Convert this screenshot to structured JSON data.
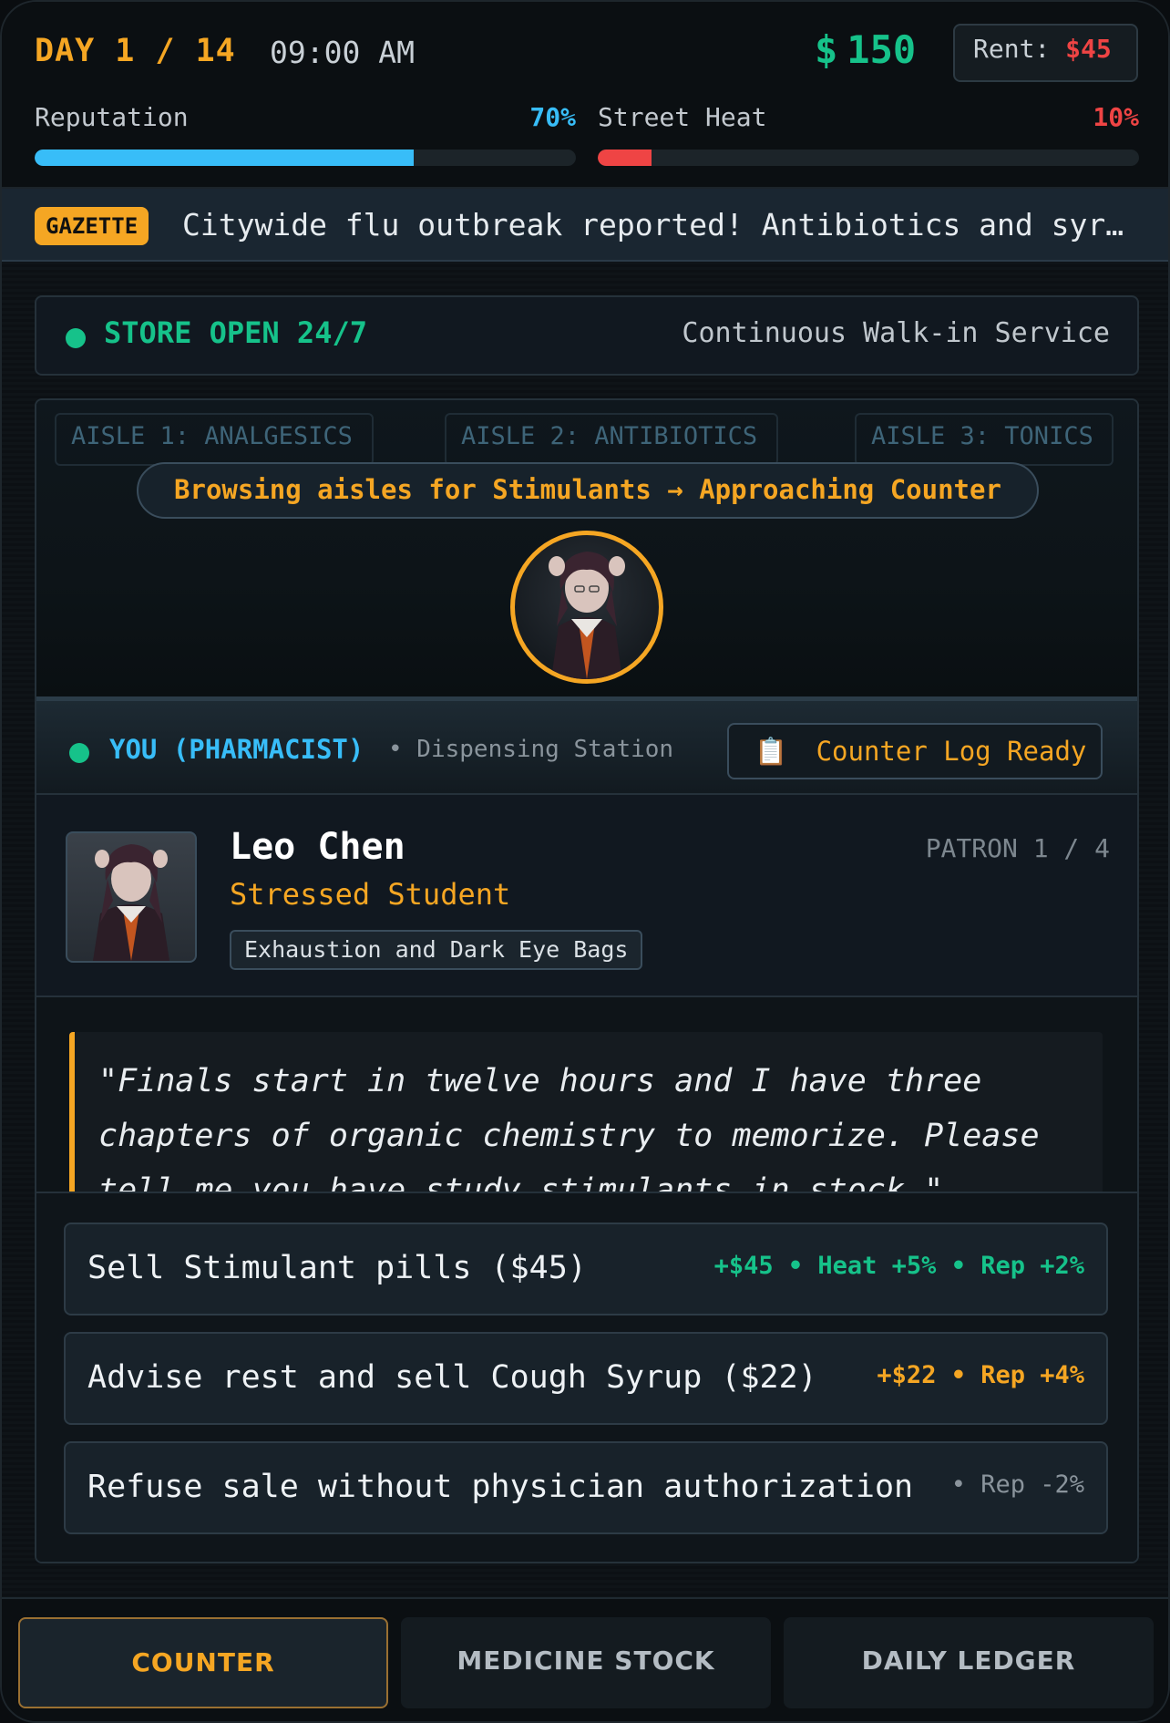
{
  "header": {
    "day": "DAY 1 / 14",
    "time": "09:00 AM",
    "money_symbol": "$",
    "money": "150",
    "rent_label": "Rent:",
    "rent_amount": "$45"
  },
  "meters": [
    {
      "label": "Reputation",
      "value_text": "70%",
      "value": 0.7,
      "color": "#38bdf8"
    },
    {
      "label": "Street Heat",
      "value_text": "10%",
      "value": 0.1,
      "color": "#ef4444"
    }
  ],
  "gazette": {
    "badge": "GAZETTE",
    "text": "Citywide flu outbreak reported! Antibiotics and syrup demand surging."
  },
  "store": {
    "status": "STORE OPEN 24/7",
    "subtitle": "Continuous Walk-in Service"
  },
  "scene": {
    "aisles": [
      "AISLE 1: ANALGESICS",
      "AISLE 2: ANTIBIOTICS",
      "AISLE 3: TONICS"
    ],
    "browse_text": "Browsing aisles for Stimulants → Approaching Counter"
  },
  "station": {
    "you_label": "YOU (PHARMACIST)",
    "station_sub": "• Dispensing Station",
    "log_icon": "📋",
    "log_label": "Counter Log Ready"
  },
  "patron": {
    "name": "Leo Chen",
    "role": "Stressed Student",
    "symptom": "Exhaustion and Dark Eye Bags",
    "count": "PATRON 1 / 4",
    "quote": "\"Finals start in twelve hours and I have three chapters of organic chemistry to memorize. Please tell me you have study stimulants in stock.\""
  },
  "choices": [
    {
      "text": "Sell Stimulant pills ($45)",
      "effects": "+$45 • Heat +5% • Rep +2%",
      "color": "#16c28a"
    },
    {
      "text": "Advise rest and sell Cough Syrup ($22)",
      "effects": "+$22 • Rep +4%",
      "color": "#f5a623"
    },
    {
      "text": "Refuse sale without physician authorization",
      "effects": "• Rep -2%",
      "color": "#8a949c"
    }
  ],
  "tabs": [
    {
      "label": "COUNTER",
      "active": true
    },
    {
      "label": "MEDICINE STOCK",
      "active": false
    },
    {
      "label": "DAILY LEDGER",
      "active": false
    }
  ]
}
